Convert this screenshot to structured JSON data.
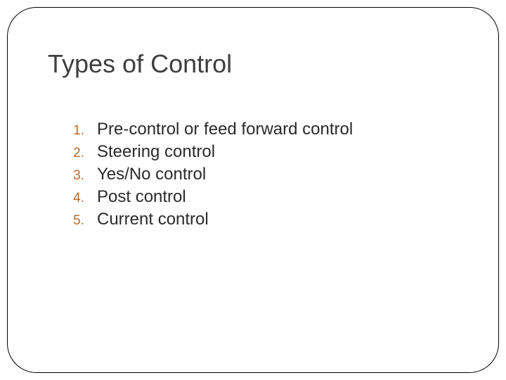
{
  "title": "Types of Control",
  "items": [
    {
      "n": "1.",
      "t": "Pre-control or feed forward control"
    },
    {
      "n": "2.",
      "t": "Steering control"
    },
    {
      "n": "3.",
      "t": "Yes/No control"
    },
    {
      "n": "4.",
      "t": "Post control"
    },
    {
      "n": "5.",
      "t": "Current control"
    }
  ]
}
